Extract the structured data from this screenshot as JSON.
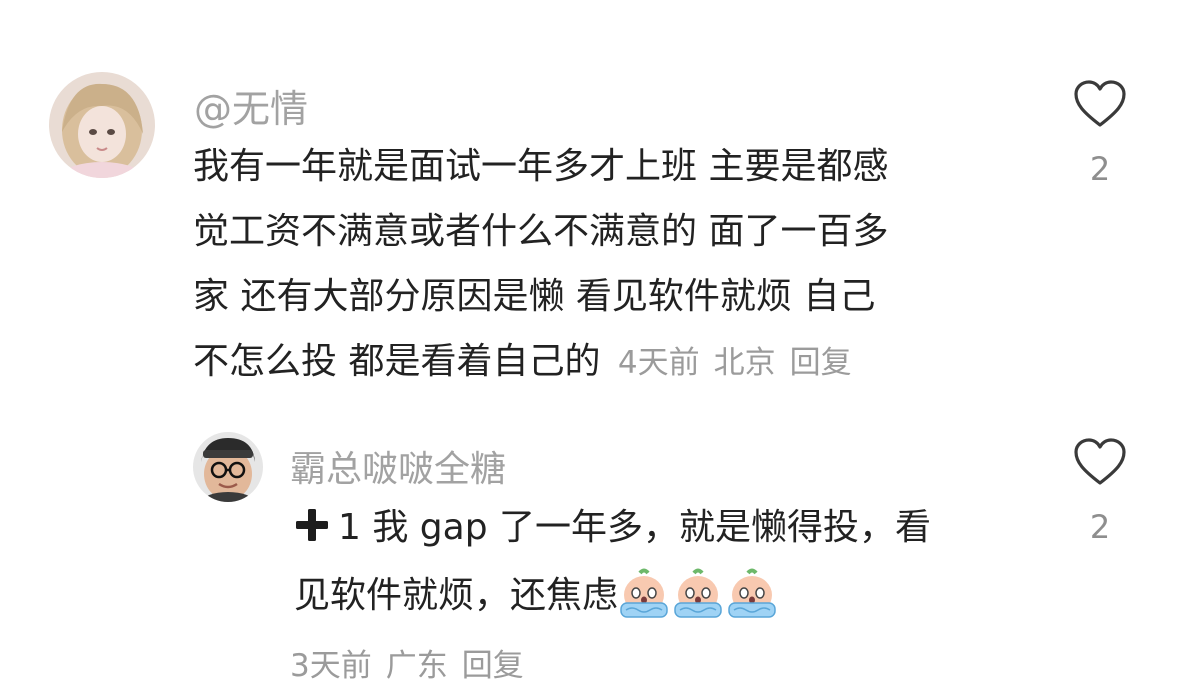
{
  "comment": {
    "username": "@无情",
    "lines": [
      "我有一年就是面试一年多才上班  主要是都感",
      "觉工资不满意或者什么不满意的 面了一百多",
      "家 还有大部分原因是懒 看见软件就烦 自己",
      "不怎么投 都是看着自己的"
    ],
    "time": "4天前",
    "location": "北京",
    "reply_label": "回复",
    "like_count": "2"
  },
  "reply": {
    "username": "霸总啵啵全糖",
    "text_line1": "1 我 gap 了一年多，就是懒得投，看",
    "text_line2": "见软件就烦，还焦虑",
    "emoji_count": 3,
    "time": "3天前",
    "location": "广东",
    "reply_label": "回复",
    "like_count": "2"
  },
  "colors": {
    "meta": "#9b9b9b",
    "username": "#a2a2a2",
    "text": "#222222"
  }
}
